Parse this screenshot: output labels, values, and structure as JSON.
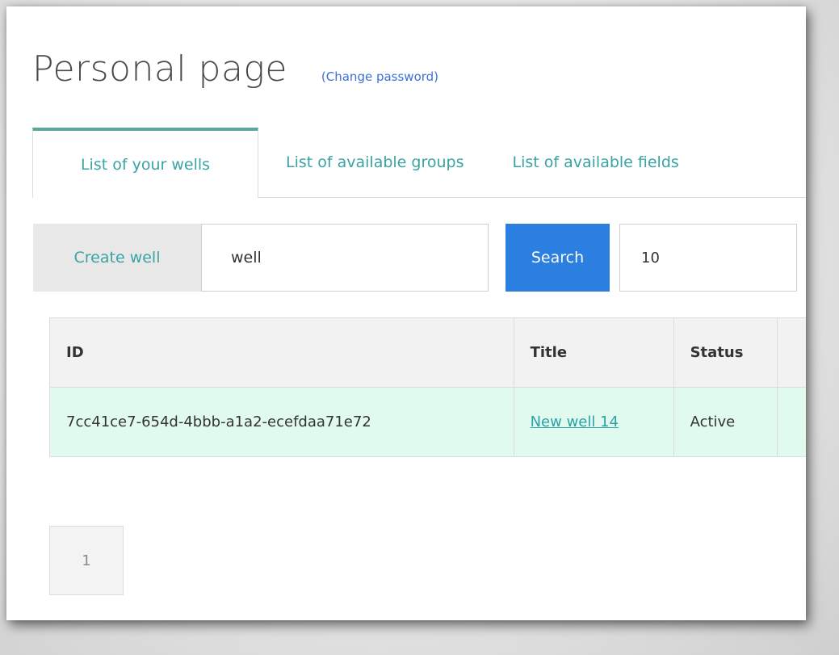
{
  "header": {
    "title": "Personal page",
    "change_password": "(Change password)"
  },
  "tabs": [
    {
      "label": "List of your wells",
      "active": true
    },
    {
      "label": "List of available groups",
      "active": false
    },
    {
      "label": "List of available fields",
      "active": false
    }
  ],
  "toolbar": {
    "create_label": "Create well",
    "search_value": "well",
    "search_label": "Search",
    "per_page_value": "10"
  },
  "table": {
    "columns": [
      "ID",
      "Title",
      "Status"
    ],
    "rows": [
      {
        "id": "7cc41ce7-654d-4bbb-a1a2-ecefdaa71e72",
        "title": "New well 14",
        "status": "Active"
      }
    ]
  },
  "pagination": {
    "current": "1"
  },
  "colors": {
    "accent": "#3aa3a3",
    "search_button": "#2a7fe0",
    "row_highlight": "#e0fbee",
    "link": "#3b6fd6"
  }
}
